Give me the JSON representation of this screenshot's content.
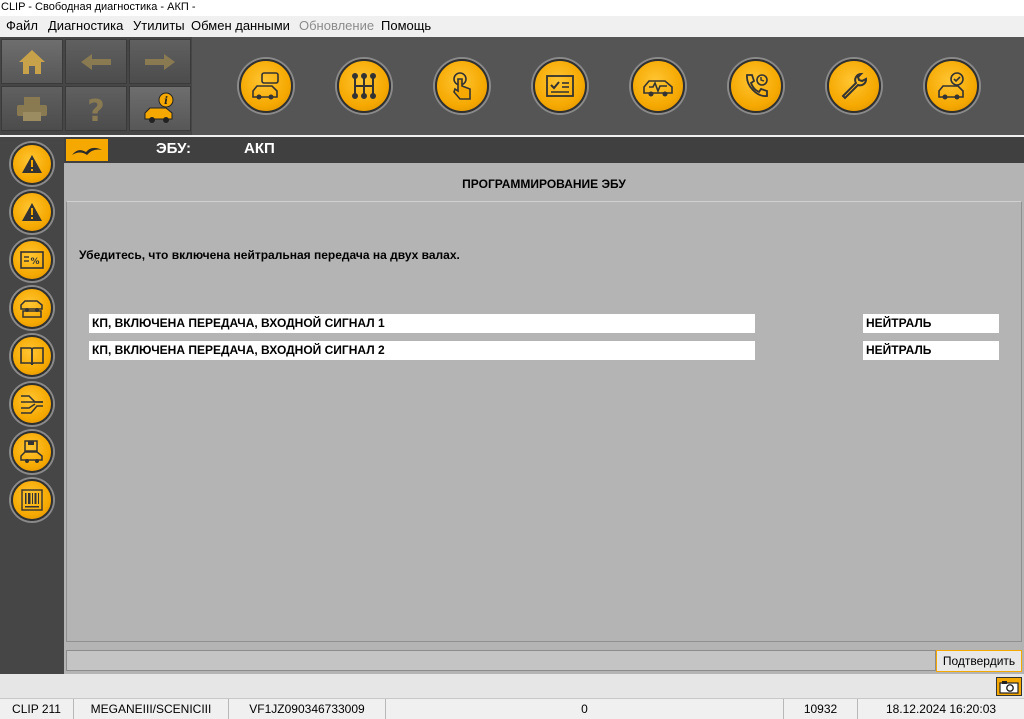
{
  "window": {
    "title": "CLIP - Свободная диагностика - АКП -"
  },
  "menu": {
    "file": "Файл",
    "diagnostics": "Диагностика",
    "utilities": "Утилиты",
    "data_exchange": "Обмен данными",
    "update": "Обновление",
    "help": "Помощь"
  },
  "toolbar": {
    "left_icons": [
      "home-icon",
      "back-arrow-icon",
      "forward-arrow-icon",
      "printer-icon",
      "help-question-icon",
      "vehicle-info-icon"
    ],
    "main_icons": [
      "vehicle-message-icon",
      "gearbox-icon",
      "touch-test-icon",
      "checklist-icon",
      "diagnostic-car-icon",
      "phone-support-icon",
      "wrench-icon",
      "vehicle-check-icon"
    ]
  },
  "sidebar": {
    "icons": [
      "warning-icon",
      "warning-icon",
      "percent-screen-icon",
      "car-ecu-icon",
      "book-icon",
      "wiring-icon",
      "save-car-icon",
      "barcode-icon"
    ]
  },
  "ecu": {
    "label": "ЭБУ:",
    "value": "АКП"
  },
  "page": {
    "title": "ПРОГРАММИРОВАНИЕ ЭБУ",
    "instruction": "Убедитесь, что включена нейтральная передача на двух валах.",
    "rows": [
      {
        "label": "КП, ВКЛЮЧЕНА ПЕРЕДАЧА, ВХОДНОЙ СИГНАЛ 1",
        "value": "НЕЙТРАЛЬ"
      },
      {
        "label": "КП, ВКЛЮЧЕНА ПЕРЕДАЧА, ВХОДНОЙ СИГНАЛ 2",
        "value": "НЕЙТРАЛЬ"
      }
    ],
    "confirm_label": "Подтвердить"
  },
  "status": {
    "tool": "CLIP 211",
    "vehicle": "MEGANEIII/SCENICIII",
    "vin": "VF1JZ090346733009",
    "counter": "0",
    "code": "10932",
    "datetime": "18.12.2024 16:20:03"
  },
  "colors": {
    "accent": "#f5a800",
    "toolbar_bg": "#464646",
    "content_bg": "#b4b4b4"
  }
}
